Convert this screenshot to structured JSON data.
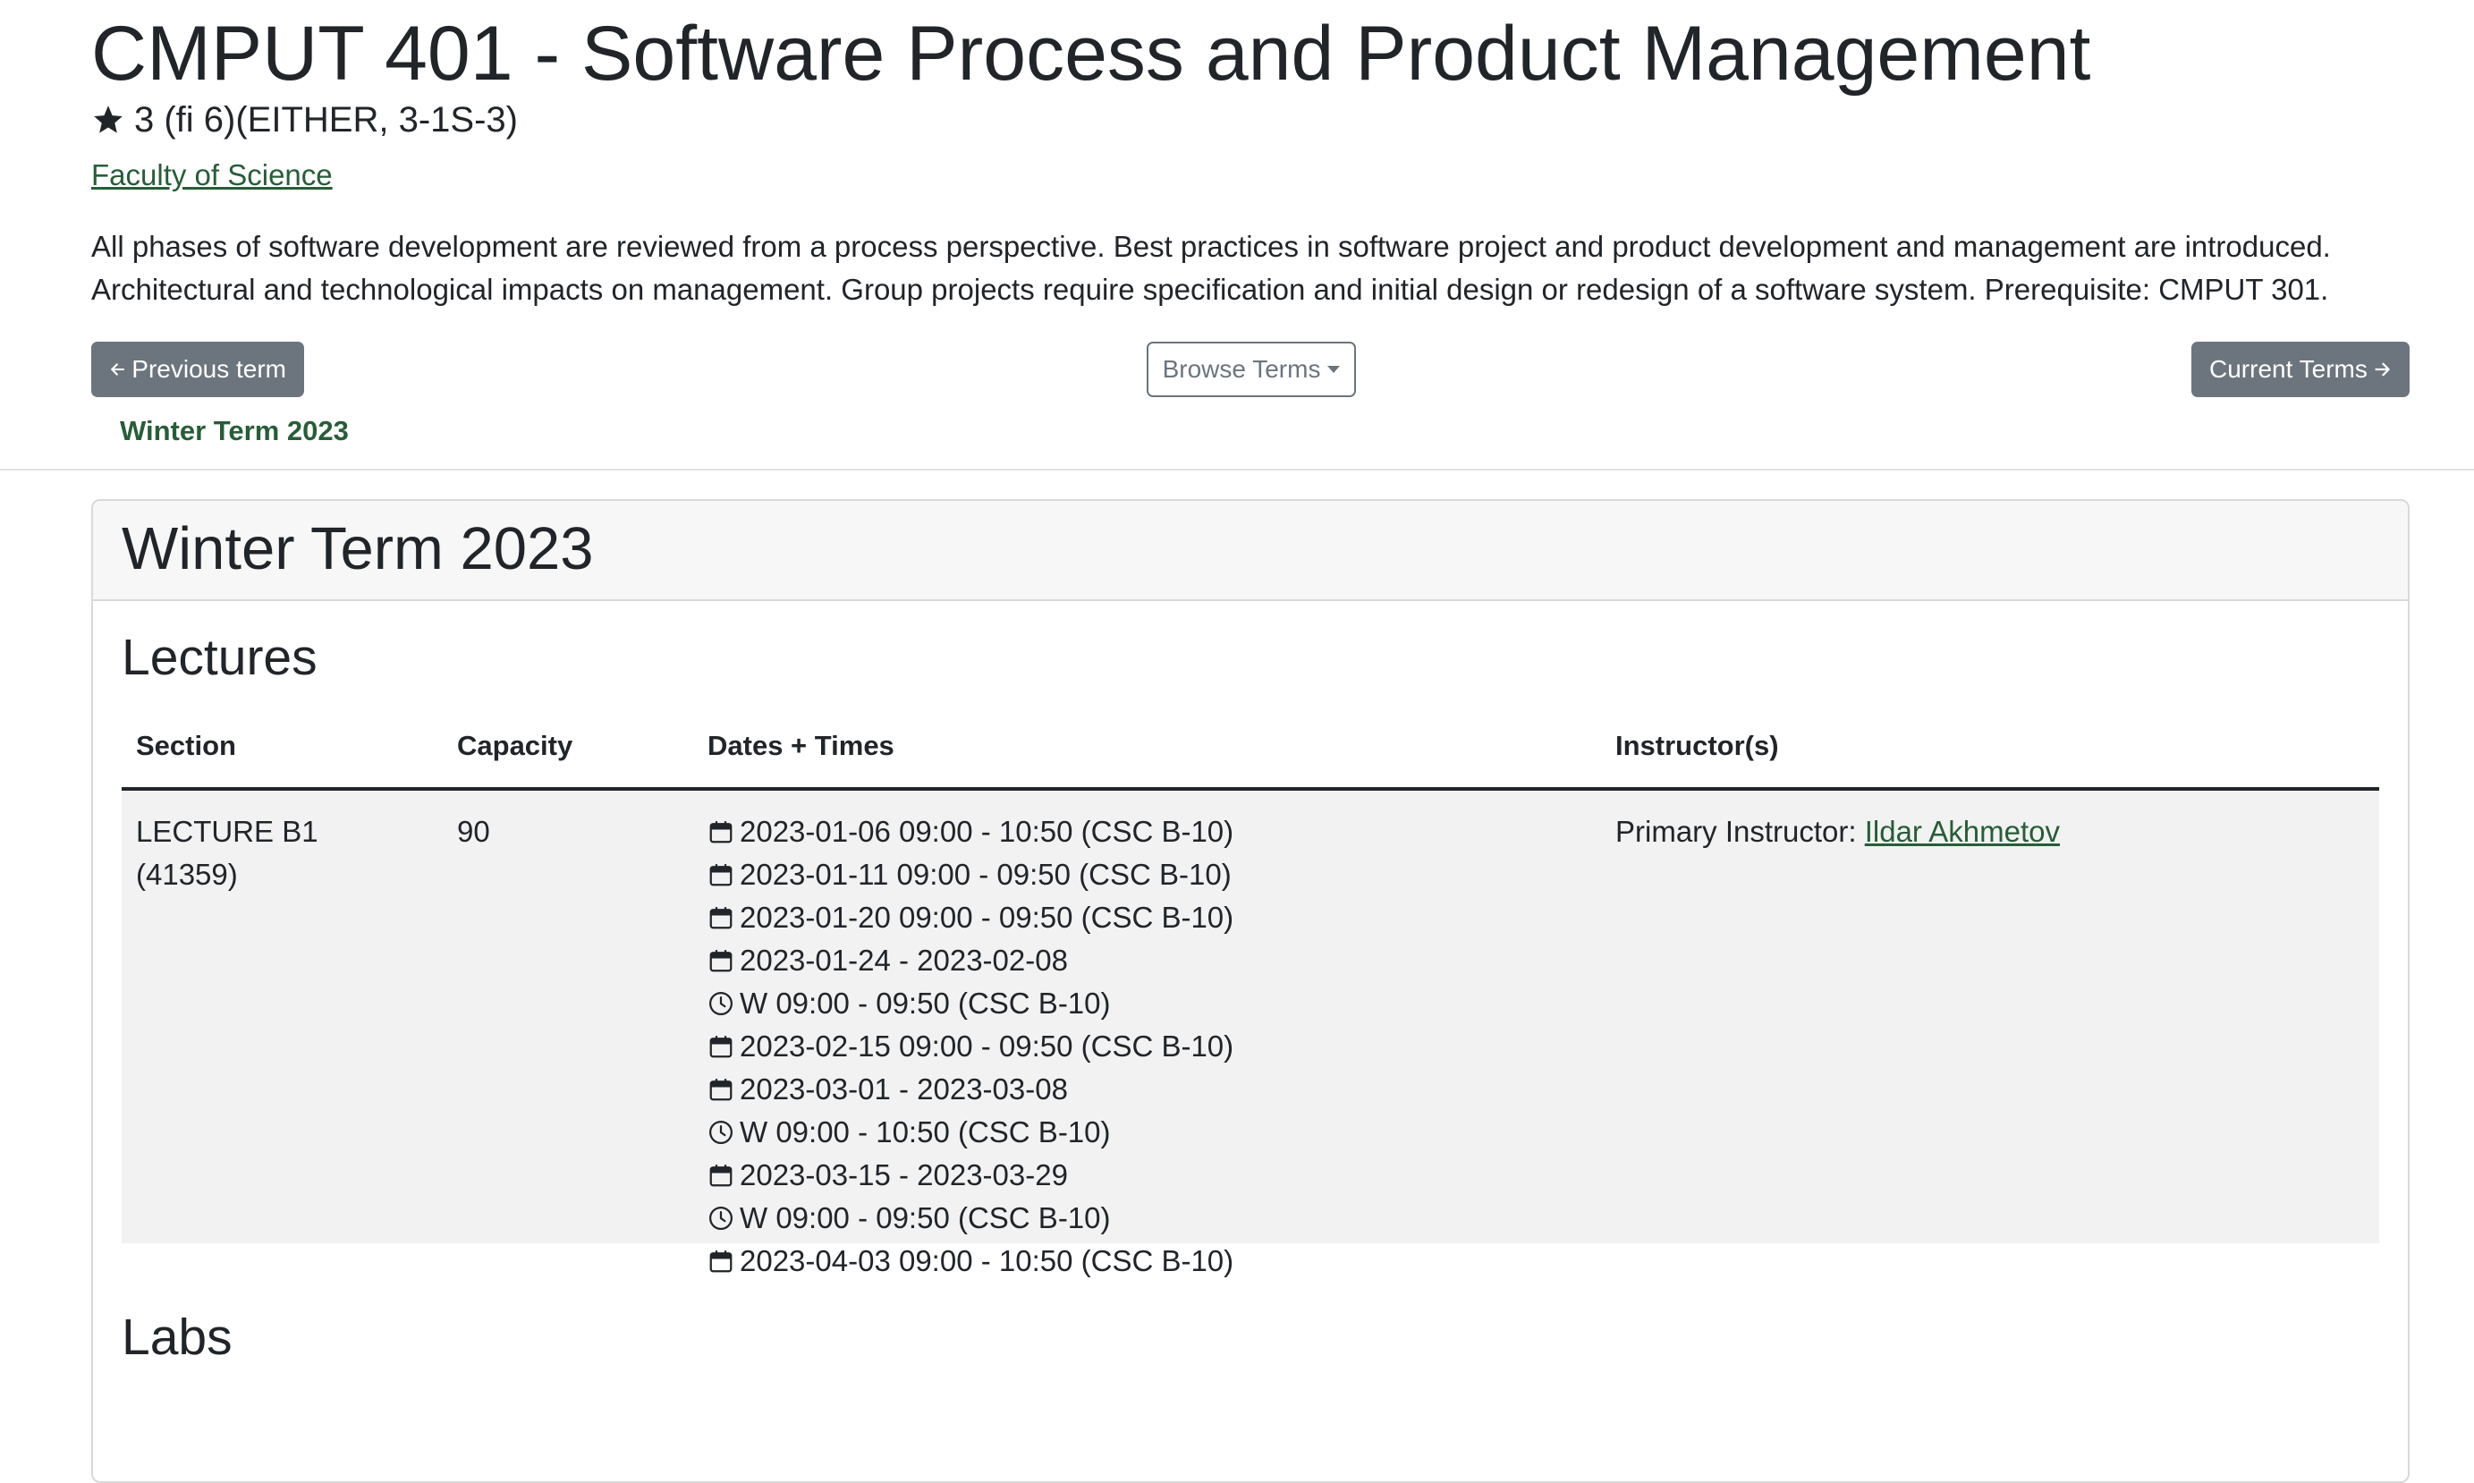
{
  "course": {
    "title": "CMPUT 401 - Software Process and Product Management",
    "credits": "3 (fi 6)(EITHER, 3-1S-3)",
    "faculty": "Faculty of Science",
    "description": "All phases of software development are reviewed from a process perspective. Best practices in software project and product development and management are introduced. Architectural and technological impacts on management. Group projects require specification and initial design or redesign of a software system. Prerequisite: CMPUT 301."
  },
  "nav": {
    "prev_label": "Previous term",
    "browse_label": "Browse Terms",
    "current_label": "Current Terms",
    "active_term": "Winter Term 2023"
  },
  "term": {
    "title": "Winter Term 2023",
    "lectures_title": "Lectures",
    "labs_title": "Labs",
    "columns": {
      "section": "Section",
      "capacity": "Capacity",
      "dates": "Dates + Times",
      "instructors": "Instructor(s)"
    },
    "lecture": {
      "section": "LECTURE B1",
      "section_id": "(41359)",
      "capacity": "90",
      "instructor_prefix": "Primary Instructor:",
      "instructor_name": "Ildar Akhmetov",
      "dates": [
        {
          "icon": "calendar-icon",
          "text": "2023-01-06 09:00 - 10:50 (CSC B-10)"
        },
        {
          "icon": "calendar-icon",
          "text": "2023-01-11 09:00 - 09:50 (CSC B-10)"
        },
        {
          "icon": "calendar-icon",
          "text": "2023-01-20 09:00 - 09:50 (CSC B-10)"
        },
        {
          "icon": "calendar-icon",
          "text": "2023-01-24 - 2023-02-08"
        },
        {
          "icon": "clock-icon",
          "text": "W 09:00 - 09:50 (CSC B-10)"
        },
        {
          "icon": "calendar-icon",
          "text": "2023-02-15 09:00 - 09:50 (CSC B-10)"
        },
        {
          "icon": "calendar-icon",
          "text": "2023-03-01 - 2023-03-08"
        },
        {
          "icon": "clock-icon",
          "text": "W 09:00 - 10:50 (CSC B-10)"
        },
        {
          "icon": "calendar-icon",
          "text": "2023-03-15 - 2023-03-29"
        },
        {
          "icon": "clock-icon",
          "text": "W 09:00 - 09:50 (CSC B-10)"
        },
        {
          "icon": "calendar-icon",
          "text": "2023-04-03 09:00 - 10:50 (CSC B-10)"
        }
      ]
    }
  },
  "colors": {
    "link_green": "#275d38",
    "button_gray": "#6c757d",
    "row_bg": "#f2f2f2"
  }
}
